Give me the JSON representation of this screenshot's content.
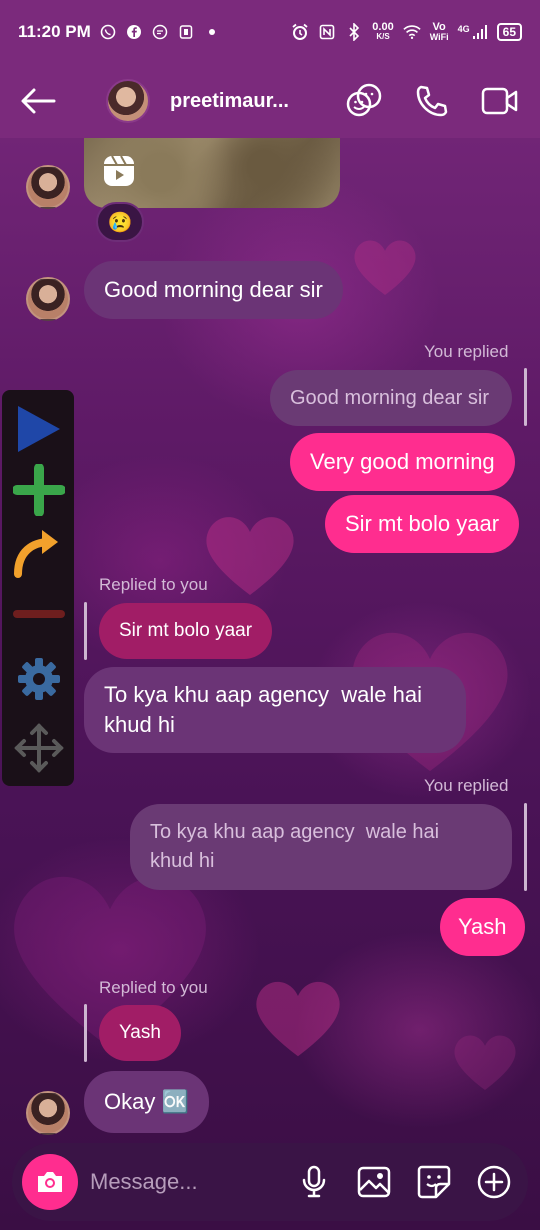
{
  "status_bar": {
    "time": "11:20 PM",
    "net_speed": "0.00",
    "net_unit": "K/S",
    "volte": "Vo",
    "wifi_label": "WiFi",
    "signal": "4G",
    "battery": "65"
  },
  "header": {
    "username": "preetimaur..."
  },
  "messages": {
    "reaction_emoji": "😢",
    "m1": "Good morning dear sir",
    "you_replied_1": "You replied",
    "quote_1": "Good morning dear sir",
    "m2": "Very good morning",
    "m3": "Sir mt bolo yaar",
    "replied_to_you_1": "Replied to you",
    "quote_2": "Sir mt bolo yaar",
    "m4_line1": "To kya khu aap agency  wale hai",
    "m4_line2": "khud hi",
    "you_replied_2": "You replied",
    "quote_3_line1": "To kya khu aap agency  wale hai",
    "quote_3_line2": "khud hi",
    "m5": "Yash",
    "replied_to_you_2": "Replied to you",
    "quote_4": "Yash",
    "m6": "Okay 🆗"
  },
  "composer": {
    "placeholder": "Message..."
  },
  "icons": {
    "back": "arrow-left-icon",
    "theme": "sticker-faces-icon",
    "call": "phone-icon",
    "video": "video-camera-icon",
    "camera": "camera-icon",
    "mic": "microphone-icon",
    "gallery": "image-icon",
    "sticker": "sticker-icon",
    "add": "plus-circle-icon"
  },
  "colors": {
    "header_bg": "#7b2a7c",
    "outgoing_bubble": "#ff2d8f",
    "incoming_bubble": "#6b3476"
  }
}
